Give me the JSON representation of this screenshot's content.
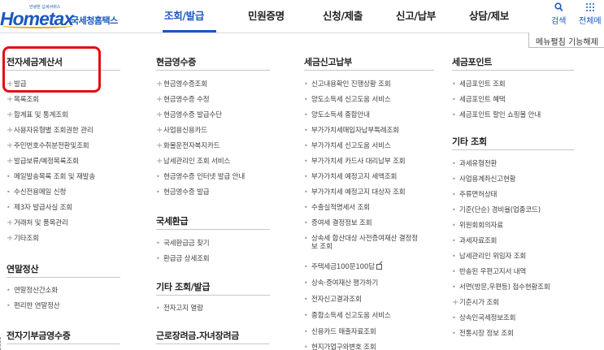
{
  "logo": {
    "small_text": "안녕한 납세서비스",
    "main_text": "Hometax",
    "sub_text": "국세청홈택스"
  },
  "nav": {
    "items": [
      "조회/발급",
      "민원증명",
      "신청/제출",
      "신고/납부",
      "상담/제보"
    ],
    "active": "조회/발급"
  },
  "header_buttons": {
    "search_label": "검색",
    "all_menu_label": "전체메"
  },
  "menu_toggle_label": "메뉴펼침 기능해제",
  "columns": [
    {
      "sections": [
        {
          "title": "전자세금계산서",
          "items": [
            {
              "bullet": "plus",
              "label": "발급"
            },
            {
              "bullet": "plus",
              "label": "목록조회"
            },
            {
              "bullet": "plus",
              "label": "합계표 및 통계조회"
            },
            {
              "bullet": "plus",
              "label": "사용자유형별 조회권한 관리"
            },
            {
              "bullet": "plus",
              "label": "주민번호수취분전환및조회"
            },
            {
              "bullet": "plus",
              "label": "발급보류/예정목록조회"
            },
            {
              "bullet": "dot",
              "label": "메일발송목록 조회 및 재발송"
            },
            {
              "bullet": "dot",
              "label": "수신전용메일 신청"
            },
            {
              "bullet": "dot",
              "label": "제3자 발급사실 조회"
            },
            {
              "bullet": "plus",
              "label": "거래처 및 품목관리"
            },
            {
              "bullet": "plus",
              "label": "기타조회"
            }
          ]
        },
        {
          "title": "연말정산",
          "items": [
            {
              "bullet": "dot",
              "label": "연말정산간소화"
            },
            {
              "bullet": "dot",
              "label": "편리한 연말정산"
            }
          ]
        },
        {
          "title": "전자기부금영수증",
          "items": []
        }
      ]
    },
    {
      "sections": [
        {
          "title": "현금영수증",
          "items": [
            {
              "bullet": "plus",
              "label": "현금영수증조회"
            },
            {
              "bullet": "plus",
              "label": "현금영수증 수정"
            },
            {
              "bullet": "plus",
              "label": "현금영수증 발급수단"
            },
            {
              "bullet": "plus",
              "label": "사업용신용카드"
            },
            {
              "bullet": "plus",
              "label": "화물운전자복지카드"
            },
            {
              "bullet": "plus",
              "label": "납세관리인 조회 서비스"
            },
            {
              "bullet": "dot",
              "label": "현금영수증 인터넷 발급 안내"
            },
            {
              "bullet": "dot",
              "label": "현금영수증 발급"
            }
          ]
        },
        {
          "title": "국세환급",
          "items": [
            {
              "bullet": "dot",
              "label": "국세환급금 찾기"
            },
            {
              "bullet": "dot",
              "label": "환급금 상세조회"
            }
          ]
        },
        {
          "title": "기타 조회/발급",
          "items": [
            {
              "bullet": "dot",
              "label": "전자고지 열람"
            }
          ]
        },
        {
          "title": "근로장려금.자녀장려금",
          "items": []
        }
      ]
    },
    {
      "sections": [
        {
          "title": "세금신고납부",
          "items": [
            {
              "bullet": "dot",
              "label": "신고내용확인 진행상황 조회"
            },
            {
              "bullet": "dot",
              "label": "양도소득세 신고도움 서비스"
            },
            {
              "bullet": "dot",
              "label": "양도소득세 종합안내"
            },
            {
              "bullet": "dot",
              "label": "부가가치세매입자납부특례조회"
            },
            {
              "bullet": "dot",
              "label": "부가가치세 신고도움 서비스"
            },
            {
              "bullet": "dot",
              "label": "부가가치세 카드사 대리납부 조회"
            },
            {
              "bullet": "dot",
              "label": "부가가치세 예정고지 세액조회"
            },
            {
              "bullet": "dot",
              "label": "부가가치세 예정고지 대상자 조회"
            },
            {
              "bullet": "dot",
              "label": "수출실적명세서 조회"
            },
            {
              "bullet": "dot",
              "label": "증여세 결정정보 조회"
            },
            {
              "bullet": "dot",
              "label": "상속세 합산대상 사전증여재산 결정정"
            },
            {
              "bullet": "none",
              "label": "보 조회"
            },
            {
              "bullet": "dot",
              "label": "주택세금100문100답",
              "external": true
            },
            {
              "bullet": "dot",
              "label": "상속·증여재산 평가하기"
            },
            {
              "bullet": "dot",
              "label": "전자신고결과조회"
            },
            {
              "bullet": "dot",
              "label": "종합소득세 신고도움 서비스"
            },
            {
              "bullet": "dot",
              "label": "신용카드 매출자료조회"
            },
            {
              "bullet": "dot",
              "label": "현지가업구와변호 조회"
            }
          ]
        }
      ]
    },
    {
      "sections": [
        {
          "title": "세금포인트",
          "items": [
            {
              "bullet": "dot",
              "label": "세금포인트 조회"
            },
            {
              "bullet": "dot",
              "label": "세금포인트 혜택"
            },
            {
              "bullet": "dot",
              "label": "세금포인트 할인 쇼핑몰 안내"
            }
          ]
        },
        {
          "title": "기타 조회",
          "items": [
            {
              "bullet": "dot",
              "label": "과세유형전환"
            },
            {
              "bullet": "dot",
              "label": "사업용계좌신고현황"
            },
            {
              "bullet": "dot",
              "label": "주류면허상태"
            },
            {
              "bullet": "dot",
              "label": "기준(단순) 경비율(업종코드)"
            },
            {
              "bullet": "dot",
              "label": "위원회회의자료"
            },
            {
              "bullet": "dot",
              "label": "과세자료조회"
            },
            {
              "bullet": "dot",
              "label": "납세관리인 위임자 조회"
            },
            {
              "bullet": "dot",
              "label": "반송된 우편고지서 내역"
            },
            {
              "bullet": "dot",
              "label": "서면(방문,우편등) 접수현황조회"
            },
            {
              "bullet": "plus",
              "label": "기준시가 조회"
            },
            {
              "bullet": "dot",
              "label": "상속인국세정보조회"
            },
            {
              "bullet": "dot",
              "label": "전통시장 정보 조회"
            }
          ]
        }
      ]
    }
  ]
}
